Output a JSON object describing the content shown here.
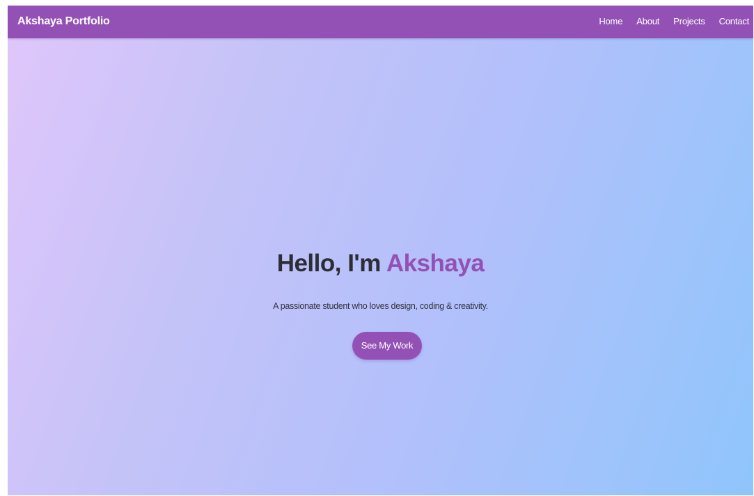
{
  "navbar": {
    "brand": "Akshaya Portfolio",
    "links": [
      "Home",
      "About",
      "Projects",
      "Contact"
    ]
  },
  "hero": {
    "greeting": "Hello, I'm",
    "name": "Akshaya",
    "subtitle": "A passionate student who loves design, coding & creativity.",
    "cta_label": "See My Work"
  },
  "colors": {
    "accent": "#9451b5",
    "heading": "#2d2d35",
    "gradient_start": "#e0c6fb",
    "gradient_end": "#8fc5fb"
  }
}
